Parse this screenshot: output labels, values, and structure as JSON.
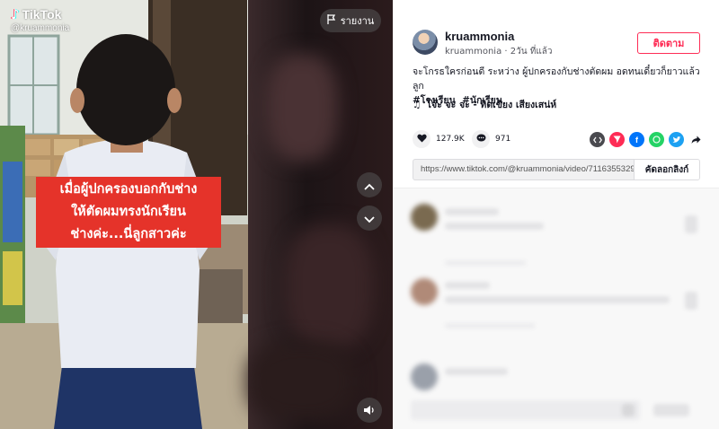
{
  "video": {
    "logo_text": "TikTok",
    "handle": "@kruammonia",
    "caption_lines": [
      "เมื่อผู้ปกครองบอกกับช่าง",
      "ให้ตัดผมทรงนักเรียน",
      "ช่างค่ะ...นี่ลูกสาวค่ะ"
    ],
    "report_label": "รายงาน",
    "icons": {
      "report": "flag-icon",
      "prev": "chevron-up-icon",
      "next": "chevron-down-icon",
      "volume": "volume-icon"
    }
  },
  "post": {
    "username": "kruammonia",
    "display_name": "kruammonia",
    "time_ago": "2วัน ที่แล้ว",
    "follow_label": "ติดตาม",
    "description": "จะโกรธใครก่อนดี ระหว่าง ผู้ปกครองกับช่างตัดผม อดทนเดี๋ยวก็ยาวแล้วลูก",
    "hashtags": [
      "#โรงเรียน",
      "#นักเรียน"
    ],
    "music": "โจ๊ะ จะ จะ - ทิดเขียง เสียงเสน่ห์",
    "likes": "127.9K",
    "comments": "971",
    "link": "https://www.tiktok.com/@kruammonia/video/7116355329...",
    "copy_link_label": "คัดลอกลิงก์",
    "share_icons": [
      "embed-icon",
      "send-icon",
      "facebook-icon",
      "whatsapp-icon",
      "twitter-icon",
      "share-arrow-icon"
    ]
  },
  "colors": {
    "accent": "#fe2c55",
    "caption_bg": "#e5332a",
    "facebook": "#0075fa",
    "whatsapp": "#25d366",
    "twitter": "#1da1f2"
  }
}
